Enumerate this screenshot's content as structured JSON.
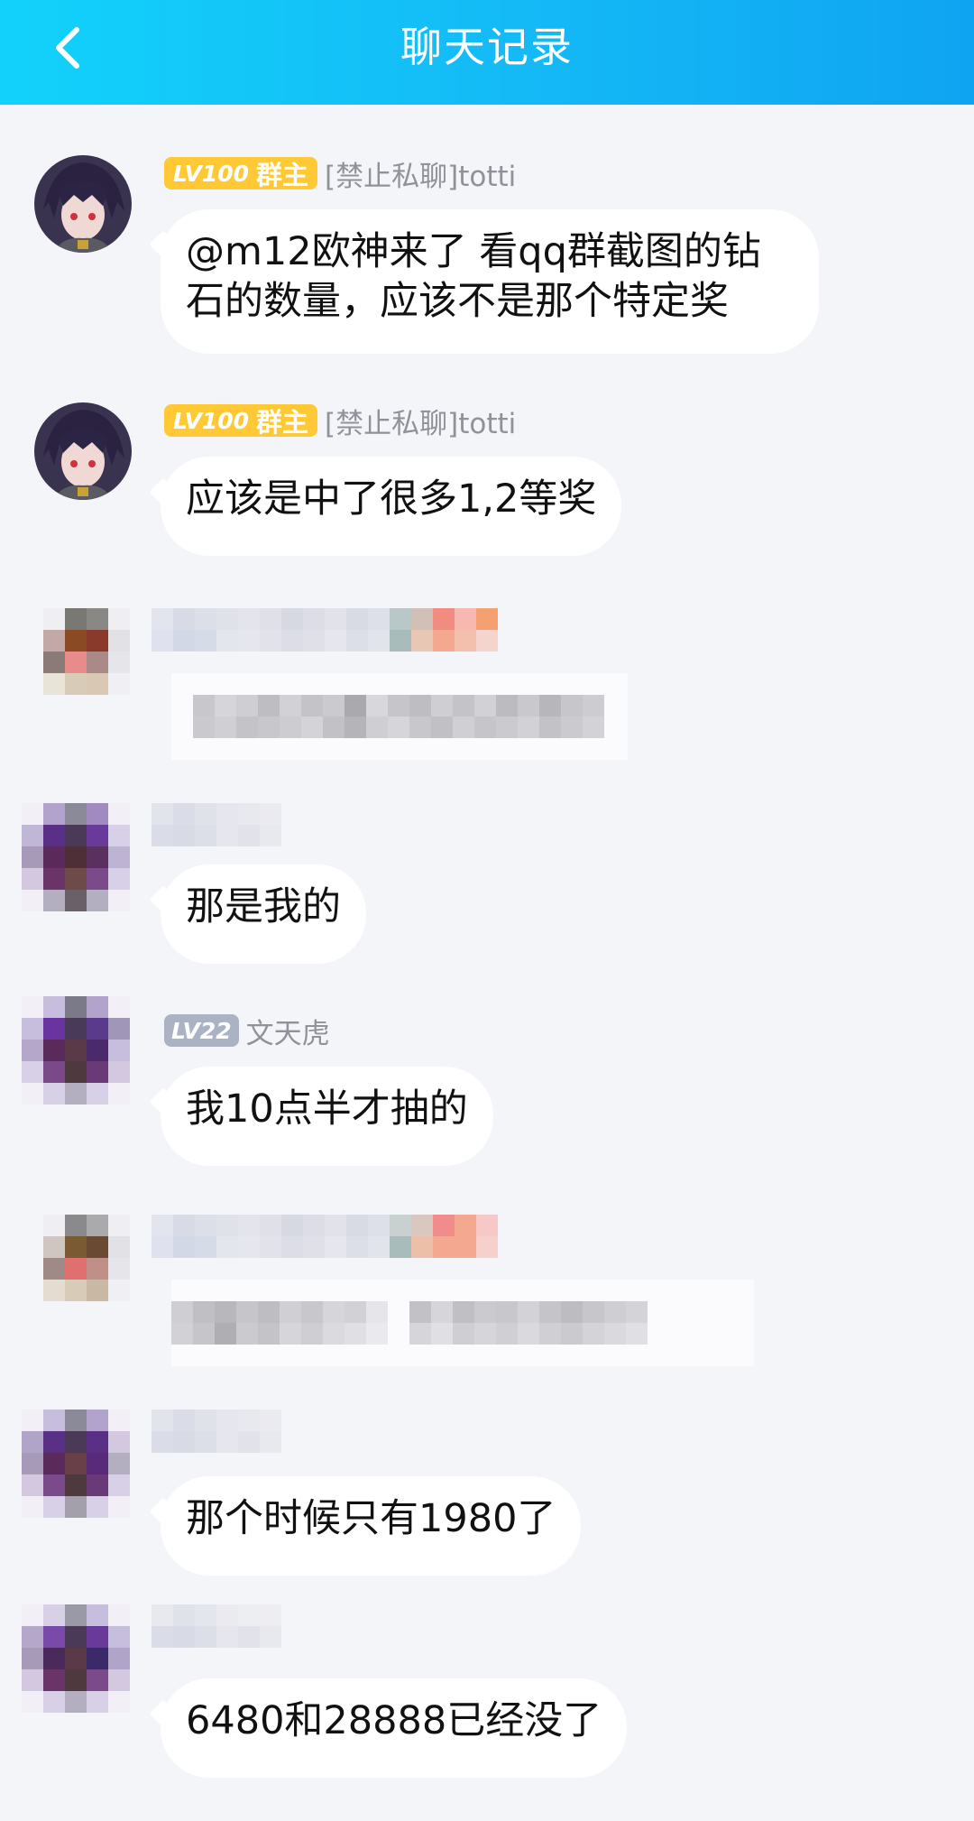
{
  "header": {
    "title": "聊天记录",
    "back_icon": "chevron-left-icon"
  },
  "messages": [
    {
      "sender": "[禁止私聊]totti",
      "level": "LV100",
      "role": "群主",
      "text": "@m12欧神来了 看qq群截图的钻石的数量，应该不是那个特定奖"
    },
    {
      "sender": "[禁止私聊]totti",
      "level": "LV100",
      "role": "群主",
      "text": "应该是中了很多1,2等奖"
    },
    {
      "sender": "",
      "text": "那是我的"
    },
    {
      "sender": "文天虎",
      "level": "LV22",
      "text": "我10点半才抽的"
    },
    {
      "sender": "",
      "text": "那个时候只有1980了"
    },
    {
      "sender": "",
      "text": "6480和28888已经没了"
    }
  ],
  "colors": {
    "header_start": "#12d2fb",
    "header_end": "#0fa4f1",
    "background": "#f4f5f9",
    "bubble": "#ffffff",
    "badge_gold": "#ffc936",
    "badge_gray": "#aab2c4"
  }
}
